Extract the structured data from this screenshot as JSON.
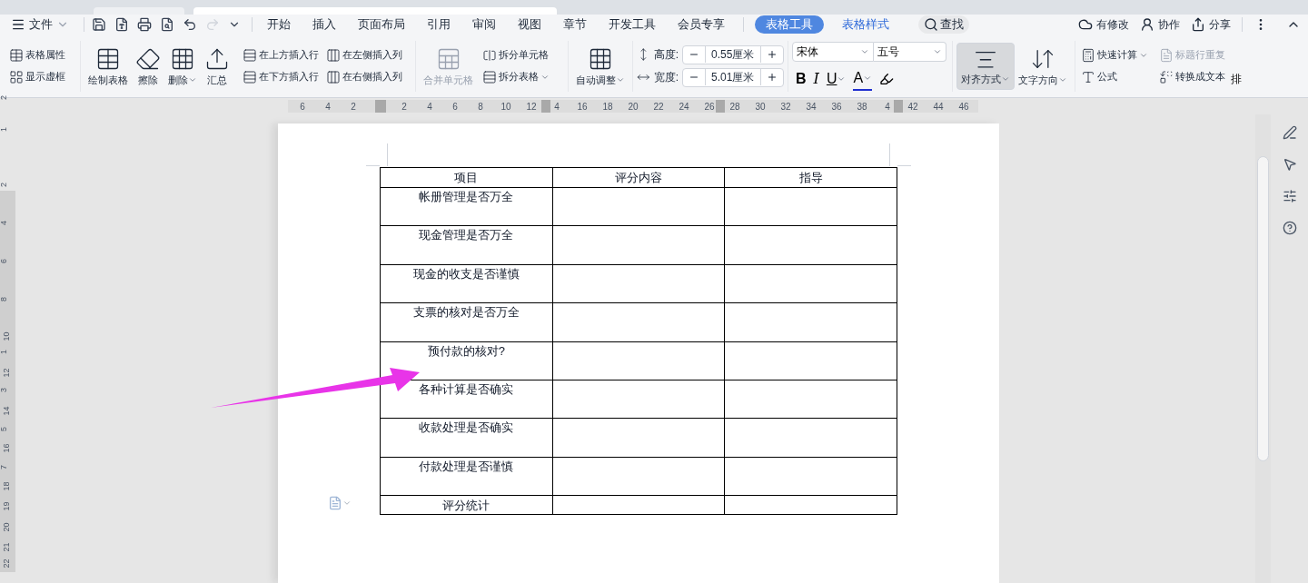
{
  "menu": {
    "file": "文件",
    "tabs": [
      {
        "label": "开始",
        "selected": false
      },
      {
        "label": "插入",
        "selected": false
      },
      {
        "label": "页面布局",
        "selected": false
      },
      {
        "label": "引用",
        "selected": false
      },
      {
        "label": "审阅",
        "selected": false
      },
      {
        "label": "视图",
        "selected": false
      },
      {
        "label": "章节",
        "selected": false
      },
      {
        "label": "开发工具",
        "selected": false
      },
      {
        "label": "会员专享",
        "selected": false
      }
    ],
    "context_tabs": [
      {
        "label": "表格工具",
        "selected": true
      },
      {
        "label": "表格样式",
        "selected": false
      }
    ],
    "search": "查找",
    "actions": [
      "有修改",
      "协作",
      "分享"
    ]
  },
  "ribbon": {
    "props": [
      "表格属性",
      "显示虚框"
    ],
    "large": [
      {
        "label": "绘制表格",
        "dropdown": false
      },
      {
        "label": "擦除",
        "dropdown": false
      },
      {
        "label": "删除",
        "dropdown": true
      },
      {
        "label": "汇总",
        "dropdown": false
      }
    ],
    "insert": [
      "在上方插入行",
      "在下方插入行",
      "在左侧插入列",
      "在右侧插入列"
    ],
    "merge": {
      "label": "合并单元格",
      "disabled": true
    },
    "split": [
      {
        "label": "拆分单元格",
        "dropdown": false
      },
      {
        "label": "拆分表格",
        "dropdown": true
      }
    ],
    "autofit": "自动调整",
    "sizes": [
      {
        "label": "高度:",
        "value": "0.55厘米"
      },
      {
        "label": "宽度:",
        "value": "5.01厘米"
      }
    ],
    "font": {
      "family": "宋体",
      "size": "五号",
      "buttons": [
        "B",
        "I",
        "U",
        "A"
      ]
    },
    "align": {
      "label": "对齐方式",
      "selected": true
    },
    "direction": "文字方向",
    "calc": [
      {
        "label": "快速计算",
        "disabled": false,
        "dropdown": true
      },
      {
        "label": "标题行重复",
        "disabled": true,
        "dropdown": false
      },
      {
        "label": "公式",
        "disabled": false,
        "dropdown": false
      },
      {
        "label": "转换成文本",
        "disabled": false,
        "dropdown": false
      }
    ],
    "cut": "排"
  },
  "ruler": {
    "h": [
      "6",
      "4",
      "2",
      "2",
      "4",
      "6",
      "8",
      "10",
      "12",
      "4",
      "16",
      "18",
      "20",
      "22",
      "24",
      "26",
      "28",
      "30",
      "32",
      "34",
      "36",
      "38",
      "4",
      "42",
      "44",
      "46"
    ],
    "v": [
      "2",
      "1",
      "2",
      "4",
      "6",
      "8",
      "10",
      "1",
      "12",
      "3",
      "14",
      "5",
      "16",
      "7",
      "18",
      "19",
      "20",
      "21",
      "22"
    ]
  },
  "table": {
    "columns": [
      "项目",
      "评分内容",
      "指导"
    ],
    "rows": [
      {
        "kind": "entry",
        "item": "帐册管理是否万全"
      },
      {
        "kind": "entry",
        "item": "现金管理是否万全"
      },
      {
        "kind": "entry",
        "item": "现金的收支是否谨慎"
      },
      {
        "kind": "entry",
        "item": "支票的核对是否万全"
      },
      {
        "kind": "entry",
        "item": "预付款的核对?"
      },
      {
        "kind": "entry",
        "item": "各种计算是否确实"
      },
      {
        "kind": "entry",
        "item": "收款处理是否确实"
      },
      {
        "kind": "entry",
        "item": "付款处理是否谨慎"
      },
      {
        "kind": "total",
        "item": "评分统计"
      }
    ]
  }
}
